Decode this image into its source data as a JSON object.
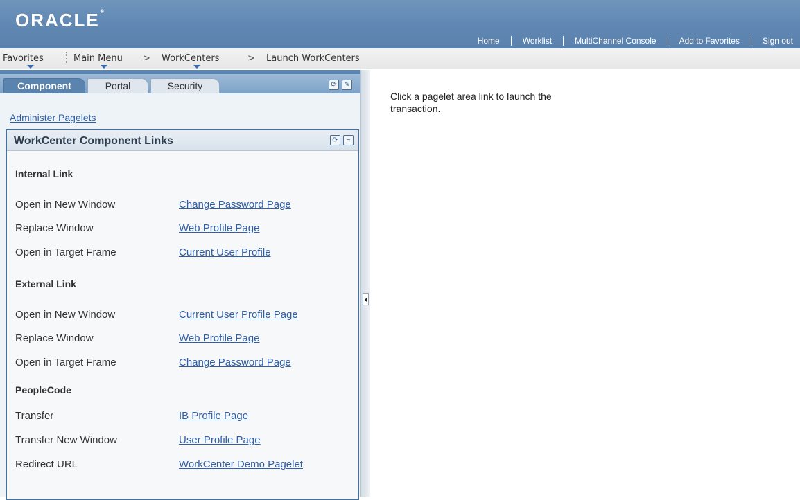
{
  "brand": {
    "logo_text": "ORACLE",
    "logo_mark": "®"
  },
  "header_links": [
    "Home",
    "Worklist",
    "MultiChannel Console",
    "Add to Favorites",
    "Sign out"
  ],
  "nav": {
    "favorites": "Favorites",
    "main_menu": "Main Menu",
    "sep": ">",
    "workcenters": "WorkCenters",
    "launch": "Launch WorkCenters"
  },
  "tabs": {
    "component": "Component",
    "portal": "Portal",
    "security": "Security"
  },
  "admin_link": "Administer Pagelets",
  "pagelet": {
    "title": "WorkCenter Component Links",
    "sections": [
      {
        "title": "Internal Link",
        "rows": [
          {
            "label": "Open in New Window",
            "link": "Change Password Page"
          },
          {
            "label": "Replace Window",
            "link": "Web Profile Page"
          },
          {
            "label": "Open in Target Frame",
            "link": "Current User Profile"
          }
        ]
      },
      {
        "title": "External Link",
        "rows": [
          {
            "label": "Open in New Window",
            "link": "Current User Profile Page"
          },
          {
            "label": "Replace Window",
            "link": "Web Profile Page"
          },
          {
            "label": "Open in Target Frame",
            "link": "Change Password Page"
          }
        ]
      },
      {
        "title": "PeopleCode",
        "rows": [
          {
            "label": "Transfer",
            "link": "IB Profile Page"
          },
          {
            "label": "Transfer New Window",
            "link": "User Profile Page"
          },
          {
            "label": "Redirect URL",
            "link": "WorkCenter Demo Pagelet"
          }
        ]
      }
    ]
  },
  "main_message": "Click a pagelet area link to launch the transaction.",
  "icons": {
    "refresh": "refresh-icon",
    "edit": "edit-icon",
    "minimize": "minimize-icon",
    "collapse": "collapse-left-icon"
  },
  "colors": {
    "banner": "#6f95bb",
    "tab_active": "#5a83ad",
    "link": "#2f5fa8",
    "pagelet_border": "#4b6f93"
  }
}
